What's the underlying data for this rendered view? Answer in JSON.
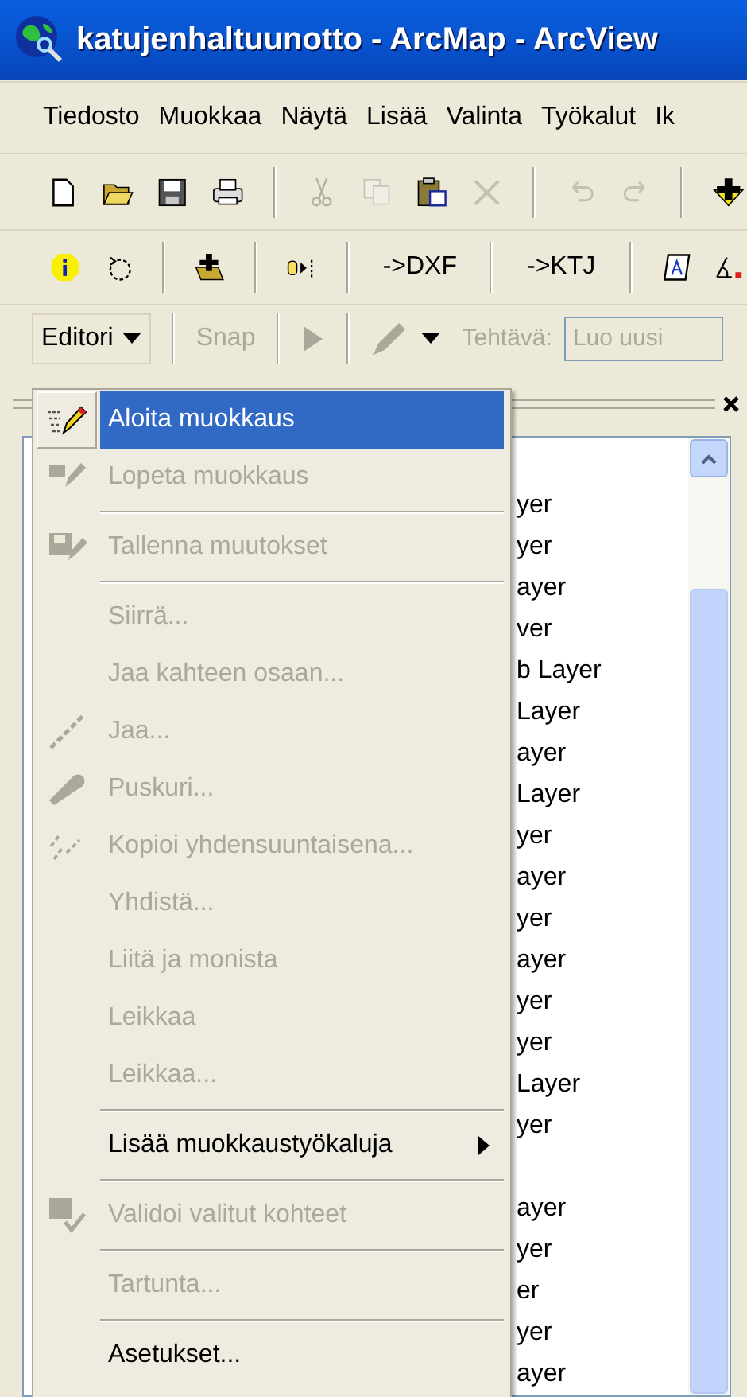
{
  "window": {
    "title": "katujenhaltuunotto - ArcMap - ArcView"
  },
  "menu_bar": [
    {
      "label": "Tiedosto"
    },
    {
      "label": "Muokkaa"
    },
    {
      "label": "Näytä"
    },
    {
      "label": "Lisää"
    },
    {
      "label": "Valinta"
    },
    {
      "label": "Työkalut"
    },
    {
      "label": "Ik"
    }
  ],
  "standard_toolbar": [
    {
      "disabled": false
    },
    {
      "disabled": false
    },
    {
      "disabled": false
    },
    {
      "disabled": false
    },
    {
      "disabled": true
    },
    {
      "disabled": true
    },
    {
      "disabled": false
    },
    {
      "disabled": true
    },
    {
      "disabled": true
    },
    {
      "disabled": true
    },
    {
      "disabled": false
    }
  ],
  "tools_toolbar": [
    {
      "kind": "icon"
    },
    {
      "kind": "icon"
    },
    {
      "kind": "icon"
    },
    {
      "kind": "icon"
    },
    {
      "kind": "text",
      "label": "->DXF"
    },
    {
      "kind": "text",
      "label": "->KTJ"
    },
    {
      "kind": "icon"
    },
    {
      "kind": "icon"
    }
  ],
  "editor_toolbar": {
    "editor_button": "Editori",
    "snap": {
      "label": "Snap",
      "disabled": true
    },
    "task_label": {
      "label": "Tehtävä:",
      "disabled": true
    },
    "task_field": {
      "value": "Luo uusi",
      "disabled": true
    }
  },
  "editor_menu": [
    {
      "kind": "item",
      "label": "Aloita muokkaus",
      "disabled": false,
      "selected": true
    },
    {
      "kind": "item",
      "label": "Lopeta muokkaus",
      "disabled": true,
      "selected": false
    },
    {
      "kind": "separator"
    },
    {
      "kind": "item",
      "label": "Tallenna muutokset",
      "disabled": true,
      "selected": false
    },
    {
      "kind": "separator"
    },
    {
      "kind": "item",
      "label": "Siirrä...",
      "disabled": true,
      "selected": false
    },
    {
      "kind": "item",
      "label": "Jaa kahteen osaan...",
      "disabled": true,
      "selected": false
    },
    {
      "kind": "item",
      "label": "Jaa...",
      "disabled": true,
      "selected": false
    },
    {
      "kind": "item",
      "label": "Puskuri...",
      "disabled": true,
      "selected": false
    },
    {
      "kind": "item",
      "label": "Kopioi yhdensuuntaisena...",
      "disabled": true,
      "selected": false
    },
    {
      "kind": "item",
      "label": "Yhdistä...",
      "disabled": true,
      "selected": false
    },
    {
      "kind": "item",
      "label": "Liitä ja monista",
      "disabled": true,
      "selected": false
    },
    {
      "kind": "item",
      "label": "Leikkaa",
      "disabled": true,
      "selected": false
    },
    {
      "kind": "item",
      "label": "Leikkaa...",
      "disabled": true,
      "selected": false
    },
    {
      "kind": "separator"
    },
    {
      "kind": "submenu",
      "label": "Lisää muokkaustyökaluja",
      "disabled": false,
      "selected": false
    },
    {
      "kind": "separator"
    },
    {
      "kind": "item",
      "label": "Validoi valitut kohteet",
      "disabled": true,
      "selected": false
    },
    {
      "kind": "separator"
    },
    {
      "kind": "item",
      "label": "Tartunta...",
      "disabled": true,
      "selected": false
    },
    {
      "kind": "separator"
    },
    {
      "kind": "item",
      "label": "Asetukset...",
      "disabled": false,
      "selected": false
    }
  ],
  "table_of_contents": {
    "layers": [
      {
        "text": "yer"
      },
      {
        "text": "yer"
      },
      {
        "text": "ayer"
      },
      {
        "text": "ver"
      },
      {
        "text": "b Layer"
      },
      {
        "text": "Layer"
      },
      {
        "text": "ayer"
      },
      {
        "text": "Layer"
      },
      {
        "text": "yer"
      },
      {
        "text": "ayer"
      },
      {
        "text": "yer"
      },
      {
        "text": "ayer"
      },
      {
        "text": "yer"
      },
      {
        "text": "yer"
      },
      {
        "text": "Layer"
      },
      {
        "text": "yer"
      },
      {
        "text": "ayer"
      },
      {
        "text": "yer"
      },
      {
        "text": "er"
      },
      {
        "text": "yer"
      },
      {
        "text": "ayer"
      }
    ]
  }
}
